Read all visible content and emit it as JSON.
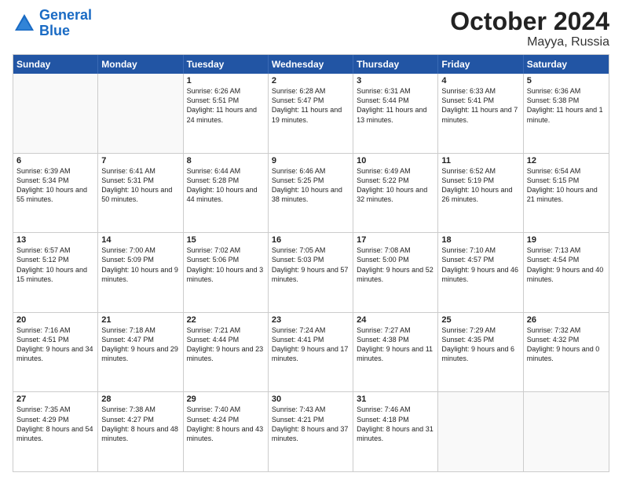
{
  "logo": {
    "line1": "General",
    "line2": "Blue"
  },
  "title": "October 2024",
  "subtitle": "Mayya, Russia",
  "header_days": [
    "Sunday",
    "Monday",
    "Tuesday",
    "Wednesday",
    "Thursday",
    "Friday",
    "Saturday"
  ],
  "weeks": [
    [
      {
        "day": "",
        "empty": true
      },
      {
        "day": "",
        "empty": true
      },
      {
        "day": "1",
        "sunrise": "Sunrise: 6:26 AM",
        "sunset": "Sunset: 5:51 PM",
        "daylight": "Daylight: 11 hours and 24 minutes."
      },
      {
        "day": "2",
        "sunrise": "Sunrise: 6:28 AM",
        "sunset": "Sunset: 5:47 PM",
        "daylight": "Daylight: 11 hours and 19 minutes."
      },
      {
        "day": "3",
        "sunrise": "Sunrise: 6:31 AM",
        "sunset": "Sunset: 5:44 PM",
        "daylight": "Daylight: 11 hours and 13 minutes."
      },
      {
        "day": "4",
        "sunrise": "Sunrise: 6:33 AM",
        "sunset": "Sunset: 5:41 PM",
        "daylight": "Daylight: 11 hours and 7 minutes."
      },
      {
        "day": "5",
        "sunrise": "Sunrise: 6:36 AM",
        "sunset": "Sunset: 5:38 PM",
        "daylight": "Daylight: 11 hours and 1 minute."
      }
    ],
    [
      {
        "day": "6",
        "sunrise": "Sunrise: 6:39 AM",
        "sunset": "Sunset: 5:34 PM",
        "daylight": "Daylight: 10 hours and 55 minutes."
      },
      {
        "day": "7",
        "sunrise": "Sunrise: 6:41 AM",
        "sunset": "Sunset: 5:31 PM",
        "daylight": "Daylight: 10 hours and 50 minutes."
      },
      {
        "day": "8",
        "sunrise": "Sunrise: 6:44 AM",
        "sunset": "Sunset: 5:28 PM",
        "daylight": "Daylight: 10 hours and 44 minutes."
      },
      {
        "day": "9",
        "sunrise": "Sunrise: 6:46 AM",
        "sunset": "Sunset: 5:25 PM",
        "daylight": "Daylight: 10 hours and 38 minutes."
      },
      {
        "day": "10",
        "sunrise": "Sunrise: 6:49 AM",
        "sunset": "Sunset: 5:22 PM",
        "daylight": "Daylight: 10 hours and 32 minutes."
      },
      {
        "day": "11",
        "sunrise": "Sunrise: 6:52 AM",
        "sunset": "Sunset: 5:19 PM",
        "daylight": "Daylight: 10 hours and 26 minutes."
      },
      {
        "day": "12",
        "sunrise": "Sunrise: 6:54 AM",
        "sunset": "Sunset: 5:15 PM",
        "daylight": "Daylight: 10 hours and 21 minutes."
      }
    ],
    [
      {
        "day": "13",
        "sunrise": "Sunrise: 6:57 AM",
        "sunset": "Sunset: 5:12 PM",
        "daylight": "Daylight: 10 hours and 15 minutes."
      },
      {
        "day": "14",
        "sunrise": "Sunrise: 7:00 AM",
        "sunset": "Sunset: 5:09 PM",
        "daylight": "Daylight: 10 hours and 9 minutes."
      },
      {
        "day": "15",
        "sunrise": "Sunrise: 7:02 AM",
        "sunset": "Sunset: 5:06 PM",
        "daylight": "Daylight: 10 hours and 3 minutes."
      },
      {
        "day": "16",
        "sunrise": "Sunrise: 7:05 AM",
        "sunset": "Sunset: 5:03 PM",
        "daylight": "Daylight: 9 hours and 57 minutes."
      },
      {
        "day": "17",
        "sunrise": "Sunrise: 7:08 AM",
        "sunset": "Sunset: 5:00 PM",
        "daylight": "Daylight: 9 hours and 52 minutes."
      },
      {
        "day": "18",
        "sunrise": "Sunrise: 7:10 AM",
        "sunset": "Sunset: 4:57 PM",
        "daylight": "Daylight: 9 hours and 46 minutes."
      },
      {
        "day": "19",
        "sunrise": "Sunrise: 7:13 AM",
        "sunset": "Sunset: 4:54 PM",
        "daylight": "Daylight: 9 hours and 40 minutes."
      }
    ],
    [
      {
        "day": "20",
        "sunrise": "Sunrise: 7:16 AM",
        "sunset": "Sunset: 4:51 PM",
        "daylight": "Daylight: 9 hours and 34 minutes."
      },
      {
        "day": "21",
        "sunrise": "Sunrise: 7:18 AM",
        "sunset": "Sunset: 4:47 PM",
        "daylight": "Daylight: 9 hours and 29 minutes."
      },
      {
        "day": "22",
        "sunrise": "Sunrise: 7:21 AM",
        "sunset": "Sunset: 4:44 PM",
        "daylight": "Daylight: 9 hours and 23 minutes."
      },
      {
        "day": "23",
        "sunrise": "Sunrise: 7:24 AM",
        "sunset": "Sunset: 4:41 PM",
        "daylight": "Daylight: 9 hours and 17 minutes."
      },
      {
        "day": "24",
        "sunrise": "Sunrise: 7:27 AM",
        "sunset": "Sunset: 4:38 PM",
        "daylight": "Daylight: 9 hours and 11 minutes."
      },
      {
        "day": "25",
        "sunrise": "Sunrise: 7:29 AM",
        "sunset": "Sunset: 4:35 PM",
        "daylight": "Daylight: 9 hours and 6 minutes."
      },
      {
        "day": "26",
        "sunrise": "Sunrise: 7:32 AM",
        "sunset": "Sunset: 4:32 PM",
        "daylight": "Daylight: 9 hours and 0 minutes."
      }
    ],
    [
      {
        "day": "27",
        "sunrise": "Sunrise: 7:35 AM",
        "sunset": "Sunset: 4:29 PM",
        "daylight": "Daylight: 8 hours and 54 minutes."
      },
      {
        "day": "28",
        "sunrise": "Sunrise: 7:38 AM",
        "sunset": "Sunset: 4:27 PM",
        "daylight": "Daylight: 8 hours and 48 minutes."
      },
      {
        "day": "29",
        "sunrise": "Sunrise: 7:40 AM",
        "sunset": "Sunset: 4:24 PM",
        "daylight": "Daylight: 8 hours and 43 minutes."
      },
      {
        "day": "30",
        "sunrise": "Sunrise: 7:43 AM",
        "sunset": "Sunset: 4:21 PM",
        "daylight": "Daylight: 8 hours and 37 minutes."
      },
      {
        "day": "31",
        "sunrise": "Sunrise: 7:46 AM",
        "sunset": "Sunset: 4:18 PM",
        "daylight": "Daylight: 8 hours and 31 minutes."
      },
      {
        "day": "",
        "empty": true
      },
      {
        "day": "",
        "empty": true
      }
    ]
  ]
}
